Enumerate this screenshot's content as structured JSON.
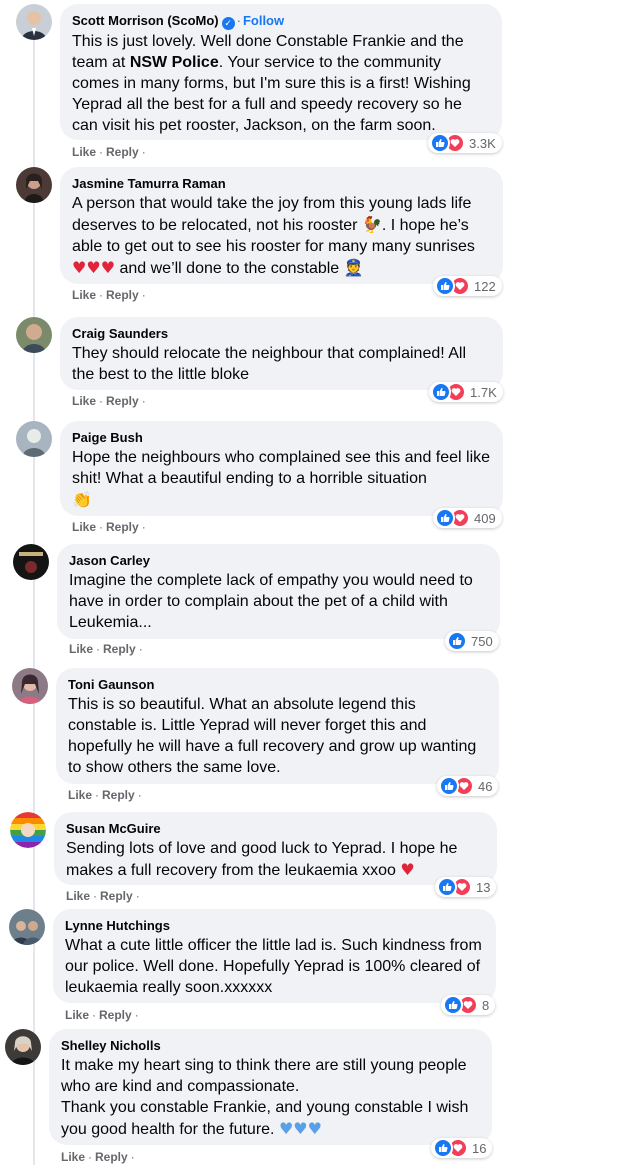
{
  "comments": [
    {
      "author": "Scott Morrison (ScoMo)",
      "verified": true,
      "follow": "Follow",
      "text_parts": [
        "This is just lovely. Well done Constable Frankie and the team at ",
        "NSW Police",
        ". Your service to the community comes in many forms, but I'm sure this is a first! Wishing Yeprad all the best for a full and speedy recovery so he can visit his pet rooster, Jackson, on the farm soon."
      ],
      "like": "Like",
      "reply": "Reply",
      "reactions": [
        "like",
        "love"
      ],
      "count": "3.3K"
    },
    {
      "author": "Jasmine Tamurra Raman",
      "text": "A person that would take the joy from this young lads life deserves to be relocated, not his rooster",
      "text_emoji1": "🐓",
      "text2": ". I hope he’s able to get out to see his rooster for many many sunrises",
      "text_emoji2": "♥♥♥",
      "text3": " and we’ll done to the constable",
      "text_emoji3": "👮",
      "like": "Like",
      "reply": "Reply",
      "reactions": [
        "like",
        "love"
      ],
      "count": "122"
    },
    {
      "author": "Craig Saunders",
      "text": "They should relocate the neighbour that complained! All the best to the little bloke",
      "like": "Like",
      "reply": "Reply",
      "reactions": [
        "like",
        "love"
      ],
      "count": "1.7K"
    },
    {
      "author": "Paige Bush",
      "text": "Hope the neighbours who complained see this and feel like shit! What a beautiful ending to a horrible situation",
      "text_emoji": "👏",
      "like": "Like",
      "reply": "Reply",
      "reactions": [
        "like",
        "love"
      ],
      "count": "409"
    },
    {
      "author": "Jason Carley",
      "text": "Imagine the complete lack of empathy you would need to have in order to complain about the pet of a child with Leukemia...",
      "like": "Like",
      "reply": "Reply",
      "reactions": [
        "like"
      ],
      "count": "750"
    },
    {
      "author": "Toni Gaunson",
      "text": "This is so beautiful. What an absolute legend this constable is. Little Yeprad will never forget this and hopefully he will have a full recovery and grow up wanting to show others the same love.",
      "like": "Like",
      "reply": "Reply",
      "reactions": [
        "like",
        "love"
      ],
      "count": "46"
    },
    {
      "author": "Susan McGuire",
      "text": "Sending lots of love and good luck to Yeprad. I hope he makes a full recovery from the leukaemia xxoo",
      "text_emoji": "♥",
      "like": "Like",
      "reply": "Reply",
      "reactions": [
        "like",
        "love"
      ],
      "count": "13"
    },
    {
      "author": "Lynne Hutchings",
      "text": "What a cute little officer the little lad is. Such kindness from our police. Well done. Hopefully Yeprad is 100% cleared of leukaemia really soon.xxxxxx",
      "like": "Like",
      "reply": "Reply",
      "reactions": [
        "like",
        "love"
      ],
      "count": "8"
    },
    {
      "author": "Shelley Nicholls",
      "text_line1": "It make my heart sing to think there are still young people who are kind and compassionate.",
      "text_line2": "Thank you constable Frankie, and young constable I wish you good health for the future.",
      "text_emoji": "♥♥♥",
      "like": "Like",
      "reply": "Reply",
      "reactions": [
        "like",
        "love"
      ],
      "count": "16"
    }
  ],
  "colors": {
    "bubble": "#f0f2f5",
    "like_blue": "#1877f2",
    "love_red": "#f33e58",
    "meta_gray": "#65676b"
  },
  "icons": {
    "like": "thumbs-up-icon",
    "love": "heart-icon",
    "verified": "verified-badge-icon"
  }
}
